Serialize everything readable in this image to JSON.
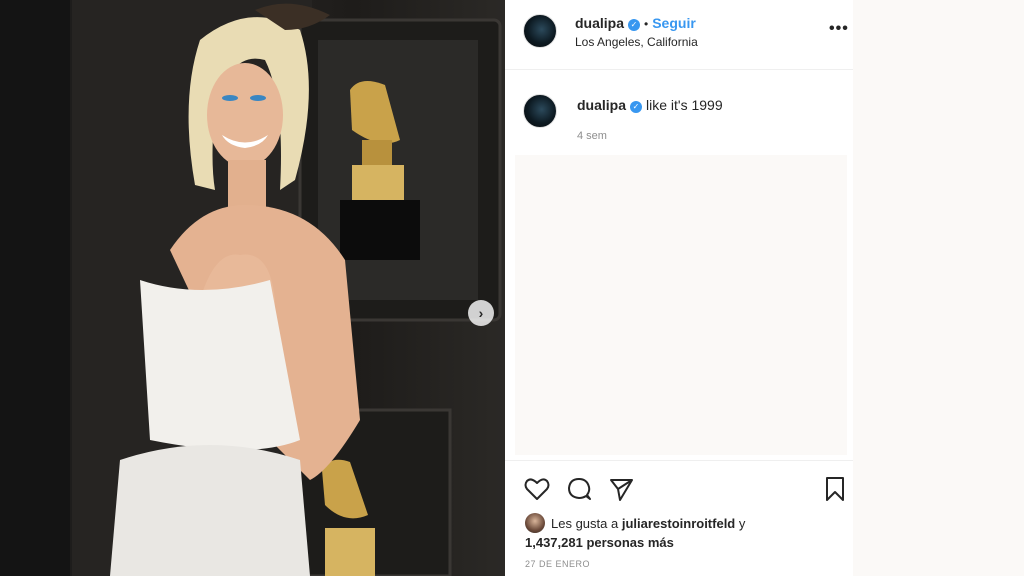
{
  "post": {
    "username": "dualipa",
    "verified_mark": "✓",
    "separator": "•",
    "follow_label": "Seguir",
    "location": "Los Angeles, California",
    "more_label": "•••",
    "caption_text": "like it's 1999",
    "time_ago": "4 sem",
    "likes_prefix": "Les gusta a",
    "likes_user": "juliarestoinroitfeld",
    "likes_and": "y",
    "likes_count": "1,437,281 personas más",
    "date": "27 DE ENERO",
    "next_label": "›"
  },
  "icons": {
    "like": "heart-icon",
    "comment": "comment-icon",
    "share": "send-icon",
    "save": "bookmark-icon",
    "next": "chevron-right-icon",
    "more": "more-options-icon"
  },
  "colors": {
    "link_blue": "#3897f0",
    "text": "#262626",
    "muted": "#8e8e8e"
  }
}
